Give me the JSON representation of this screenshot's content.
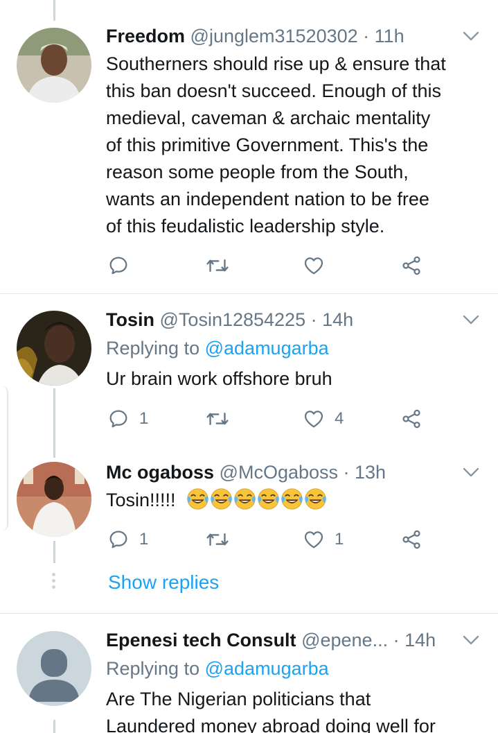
{
  "tweets": [
    {
      "name": "Freedom",
      "handle": "@junglem31520302",
      "time": "· 11h",
      "lines": [
        "Southerners should rise up & ensure that",
        "this ban doesn't succeed. Enough of this",
        "medieval, caveman & archaic mentality",
        "of this primitive Government. This's the",
        "reason some people from the South,",
        "wants an independent nation to be free",
        "of this feudalistic leadership style."
      ]
    },
    {
      "name": "Tosin",
      "handle": "@Tosin12854225",
      "time": "· 14h",
      "replying_prefix": "Replying to",
      "replying_handle": "@adamugarba",
      "text": "Ur brain work offshore bruh",
      "reply_count": "1",
      "like_count": "4"
    },
    {
      "name": "Mc ogaboss",
      "handle": "@McOgaboss",
      "time": "· 13h",
      "text": "Tosin!!!!!",
      "emoji_count": 6,
      "reply_count": "1",
      "like_count": "1"
    },
    {
      "name": "Epenesi tech Consult",
      "handle": "@epene...",
      "time": "· 14h",
      "replying_prefix": "Replying to",
      "replying_handle": "@adamugarba",
      "lines": [
        "Are The Nigerian politicians that",
        "Laundered  money abroad doing well for"
      ]
    }
  ],
  "show_replies": "Show replies",
  "icons": [
    "reply-icon",
    "retweet-icon",
    "like-icon",
    "share-icon",
    "chevron-down-icon",
    "face-with-tears-of-joy-emoji"
  ],
  "colors": {
    "link": "#1da1f2",
    "meta": "#657786",
    "divider": "#e1e8ed",
    "icon": "#657786"
  }
}
